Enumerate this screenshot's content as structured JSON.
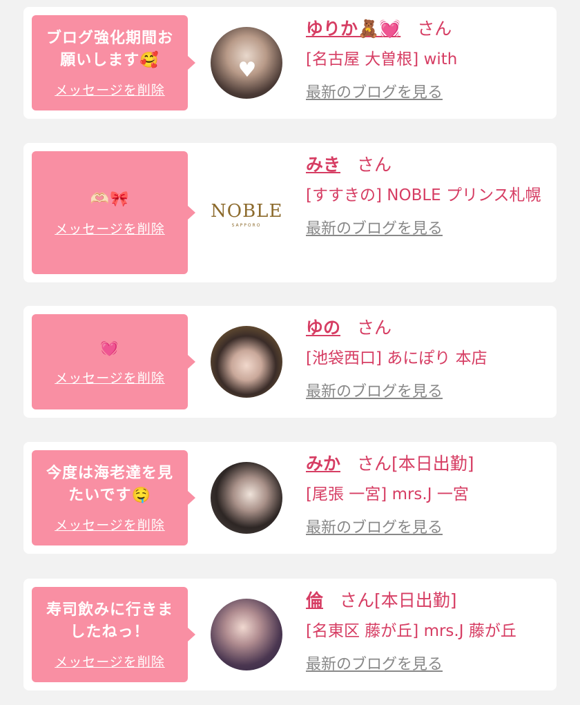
{
  "delete_label": "メッセージを削除",
  "blog_link_label": "最新のブログを見る",
  "colors": {
    "accent": "#d63d63",
    "bubble": "#f98fa3",
    "link_gray": "#888888"
  },
  "messages": [
    {
      "bubble_text": "ブログ強化期間お願いします🥰",
      "name": "ゆりか🧸💓",
      "san": "さん",
      "status": "",
      "shop": "[名古屋 大曽根] with",
      "avatar": "photo"
    },
    {
      "bubble_text": "🫶🏻🎀",
      "name": "みき",
      "san": "さん",
      "status": "",
      "shop": "[すすきの] NOBLE プリンス札幌",
      "avatar": "logo",
      "logo_text": "NOBLE",
      "logo_sub": "SAPPORO"
    },
    {
      "bubble_text": "💓",
      "name": "ゆの",
      "san": "さん",
      "status": "",
      "shop": "[池袋西口] あにぽり 本店",
      "avatar": "photo"
    },
    {
      "bubble_text": "今度は海老達を見たいです🤤",
      "name": "みか",
      "san": "さん",
      "status": "[本日出勤]",
      "shop": "[尾張 一宮] mrs.J 一宮",
      "avatar": "photo"
    },
    {
      "bubble_text": "寿司飲みに行きましたねっ！",
      "name": "倫",
      "san": "さん",
      "status": "[本日出勤]",
      "shop": "[名東区 藤が丘] mrs.J 藤が丘",
      "avatar": "photo"
    }
  ]
}
